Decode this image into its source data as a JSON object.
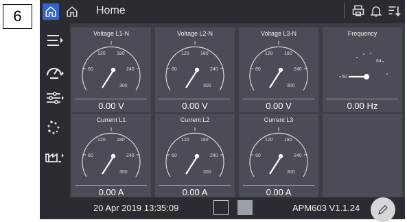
{
  "label": "6",
  "header": {
    "title": "Home"
  },
  "tiles": [
    {
      "title": "Voltage L1-N",
      "value": "0.00 V",
      "ticks": [
        "60",
        "120",
        "180",
        "240",
        "300"
      ]
    },
    {
      "title": "Voltage L2-N",
      "value": "0.00 V",
      "ticks": [
        "60",
        "120",
        "180",
        "240",
        "300"
      ]
    },
    {
      "title": "Voltage L3-N",
      "value": "0.00 V",
      "ticks": [
        "60",
        "120",
        "180",
        "240",
        "300"
      ]
    },
    {
      "title": "Frequency",
      "value": "0.00 Hz",
      "ticks": [
        "50",
        "64"
      ]
    },
    {
      "title": "Current L1",
      "value": "0.00 A",
      "ticks": [
        "60",
        "120",
        "180",
        "240",
        "300"
      ]
    },
    {
      "title": "Current L2",
      "value": "0.00 A",
      "ticks": [
        "60",
        "120",
        "180",
        "240",
        "300"
      ]
    },
    {
      "title": "Current L3",
      "value": "0.00 A",
      "ticks": [
        "60",
        "120",
        "180",
        "240",
        "300"
      ]
    }
  ],
  "footer": {
    "datetime": "20 Apr 2019 13:35:09",
    "version": "APM603 V1.1.24"
  },
  "icons": {
    "topbar": [
      "home-icon",
      "home-outline-icon",
      "printer-icon",
      "bell-icon",
      "sort-icon"
    ],
    "sidebar": [
      "menu-expand-icon",
      "gauge-icon",
      "settings-sliders-icon",
      "dots-circle-icon",
      "factory-icon"
    ],
    "footer": [
      "edit-pencil-icon"
    ]
  },
  "colors": {
    "background": "#3b3e45",
    "bar": "#2a2c32",
    "tile": "#4a4d55",
    "accent": "#2f66c8"
  }
}
